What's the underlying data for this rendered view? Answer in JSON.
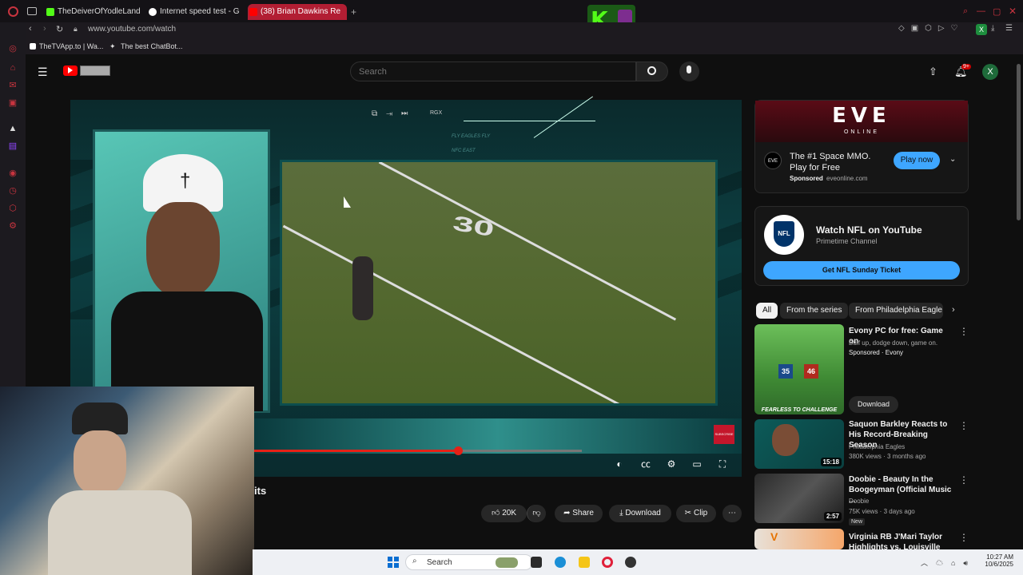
{
  "browser": {
    "tabs": [
      {
        "label": "TheDeiverOfYodleLand V",
        "color": "#53fc18"
      },
      {
        "label": "Internet speed test - Goo",
        "color": "#4285f4"
      },
      {
        "label": "(38) Brian Dawkins Re",
        "color": "#ff0000"
      }
    ],
    "url": "www.youtube.com/watch",
    "bookmarks": [
      "TheTVApp.to | Wa...",
      "The best ChatBot..."
    ],
    "kick_logo": "K"
  },
  "youtube": {
    "search_placeholder": "Search",
    "notification_count": "9+",
    "avatar_letter": "X"
  },
  "player": {
    "progress": 0.62,
    "overlay_text_1": "FLY EAGLES FLY",
    "overlay_text_2": "NFC EAST",
    "overlay_rgx": "RGX",
    "field_number": "30",
    "subscribe_label": "SUBSCRIBE",
    "title_fragment": "its"
  },
  "actions": {
    "likes": "20K",
    "share": "Share",
    "download": "Download",
    "clip": "Clip"
  },
  "ads": {
    "eve": {
      "logo": "EVE",
      "logo_sub": "ONLINE",
      "headline": "The #1 Space MMO. Play for Free",
      "sponsored": "Sponsored",
      "domain": "eveonline.com",
      "cta": "Play now"
    },
    "nfl": {
      "title": "Watch NFL on YouTube",
      "subtitle": "Primetime Channel",
      "cta": "Get NFL Sunday Ticket",
      "logo": "NFL"
    }
  },
  "chips": [
    "All",
    "From the series",
    "From Philadelphia Eagle"
  ],
  "recommendations": [
    {
      "title": "Evony PC for free: Game on",
      "line2": "Buff up, dodge down, game on.",
      "line3": "Sponsored · Evony",
      "cta": "Download",
      "thumb_text": "FEARLESS TO CHALLENGE",
      "thumb_numbers": [
        "35",
        "46"
      ]
    },
    {
      "title": "Saquon Barkley Reacts to His Record-Breaking Season",
      "channel": "Philadelphia Eagles",
      "meta": "380K views · 3 months ago",
      "duration": "15:18"
    },
    {
      "title": "Doobie - Beauty In the Boogeyman (Official Music ...",
      "channel": "Doobie",
      "meta": "75K views · 3 days ago",
      "badge": "New",
      "duration": "2:57"
    },
    {
      "title": "Virginia RB J'Mari Taylor Highlights vs. Louisville",
      "thumb_text": "V"
    }
  ],
  "taskbar": {
    "search": "Search",
    "time": "10:27 AM",
    "date": "10/6/2025"
  },
  "colors": {
    "accent": "#e62117",
    "tab_active": "#b21e33",
    "opera_red": "#c8343f",
    "youtube_blue": "#3ea6ff",
    "play_now": "#065fd4"
  }
}
